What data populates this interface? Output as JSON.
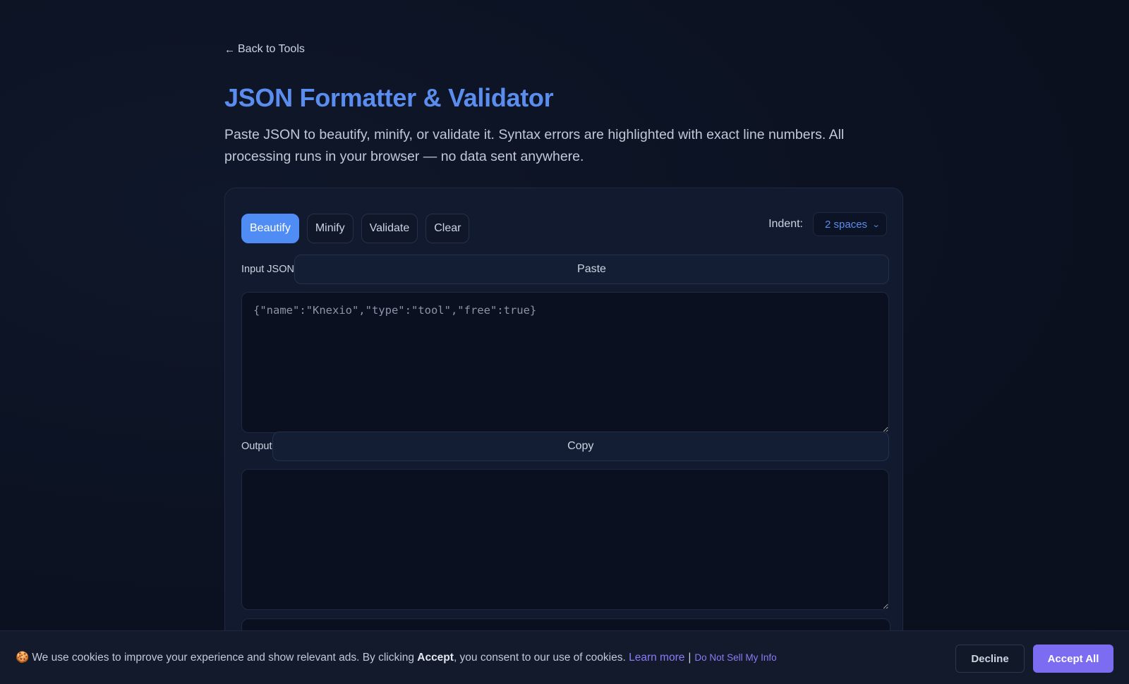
{
  "nav": {
    "back_arrow": "←",
    "back_label": "Back to Tools"
  },
  "header": {
    "title": "JSON Formatter & Validator",
    "description": "Paste JSON to beautify, minify, or validate it. Syntax errors are highlighted with exact line numbers. All processing runs in your browser — no data sent anywhere."
  },
  "toolbar": {
    "beautify_label": "Beautify",
    "minify_label": "Minify",
    "validate_label": "Validate",
    "clear_label": "Clear",
    "active": "Beautify"
  },
  "indent": {
    "label": "Indent:",
    "selected": "2 spaces"
  },
  "input": {
    "label": "Input JSON",
    "paste_label": "Paste",
    "placeholder": "{\"name\":\"Knexio\",\"type\":\"tool\",\"free\":true}"
  },
  "output": {
    "label": "Output",
    "copy_label": "Copy"
  },
  "cookie": {
    "icon": "🍪",
    "text_before": "We use cookies to improve your experience and show relevant ads. By clicking ",
    "text_bold": "Accept",
    "text_after": ", you consent to our use of cookies. ",
    "learn_more": "Learn more",
    "separator": "|",
    "do_not_sell": "Do Not Sell My Info",
    "decline_label": "Decline",
    "accept_label": "Accept All"
  },
  "colors": {
    "accent": "#4f8df5",
    "title": "#5b8def",
    "cookie_accent": "#7c6cf2",
    "background": "#0b1120"
  }
}
